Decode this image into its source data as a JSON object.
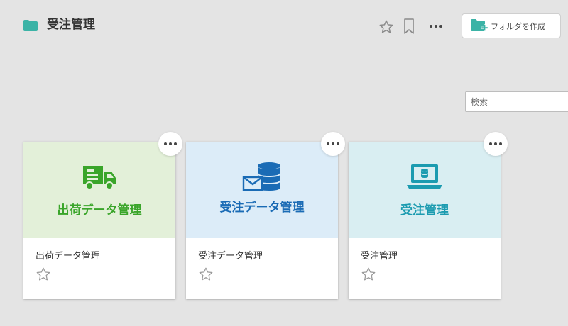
{
  "header": {
    "title": "受注管理",
    "create_folder_label": "フォルダを作成",
    "icons": [
      "folder-icon",
      "star-icon",
      "bookmark-icon",
      "more-icon",
      "folder-add-icon"
    ]
  },
  "search": {
    "placeholder": "検索"
  },
  "cards": [
    {
      "banner_title": "出荷データ管理",
      "name": "出荷データ管理",
      "icon": "truck-icon",
      "accent": "#3aa52a",
      "banner_bg": "#e3f0d9"
    },
    {
      "banner_title": "受注データ管理",
      "name": "受注データ管理",
      "icon": "mail-database-icon",
      "accent": "#1a6bb5",
      "banner_bg": "#dcecf8"
    },
    {
      "banner_title": "受注管理",
      "name": "受注管理",
      "icon": "laptop-database-icon",
      "accent": "#1b9bb0",
      "banner_bg": "#d9eef2"
    }
  ],
  "colors": {
    "folder": "#3bb3a6",
    "background": "#e4e4e4"
  }
}
